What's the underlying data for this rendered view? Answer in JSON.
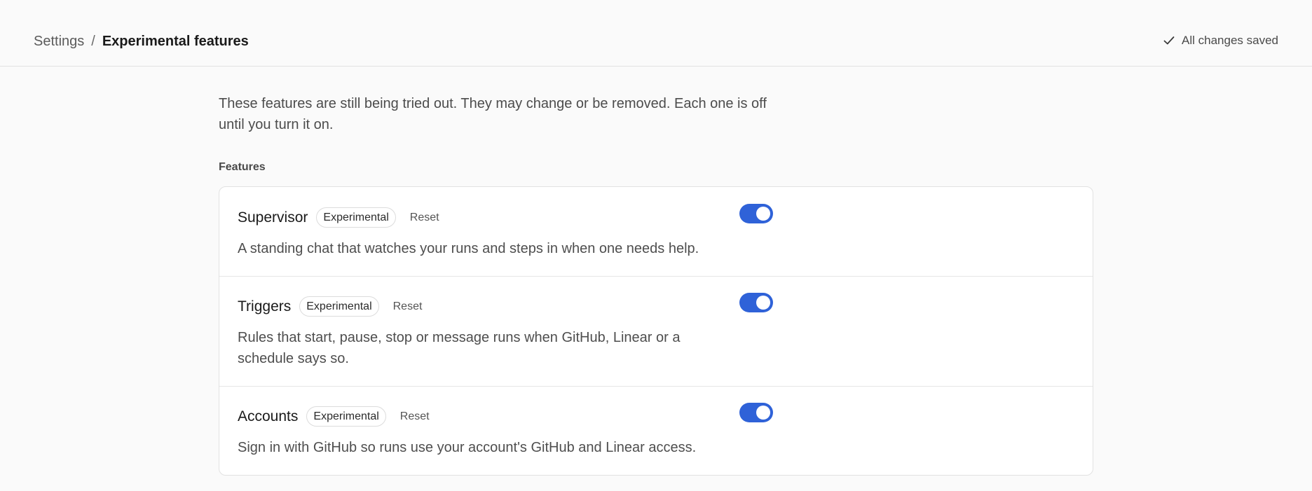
{
  "header": {
    "breadcrumb_root": "Settings",
    "breadcrumb_separator": "/",
    "breadcrumb_current": "Experimental features",
    "status_text": "All changes saved",
    "status_icon": "check-icon"
  },
  "intro": "These features are still being tried out. They may change or be removed. Each one is off until you turn it on.",
  "section_label": "Features",
  "features": [
    {
      "name": "Supervisor",
      "badge": "Experimental",
      "reset_label": "Reset",
      "description": "A standing chat that watches your runs and steps in when one needs help.",
      "enabled": true
    },
    {
      "name": "Triggers",
      "badge": "Experimental",
      "reset_label": "Reset",
      "description": "Rules that start, pause, stop or message runs when GitHub, Linear or a schedule says so.",
      "enabled": true
    },
    {
      "name": "Accounts",
      "badge": "Experimental",
      "reset_label": "Reset",
      "description": "Sign in with GitHub so runs use your account's GitHub and Linear access.",
      "enabled": true
    }
  ],
  "colors": {
    "toggle_on": "#2f62d8",
    "background": "#fafafa",
    "card": "#ffffff"
  }
}
